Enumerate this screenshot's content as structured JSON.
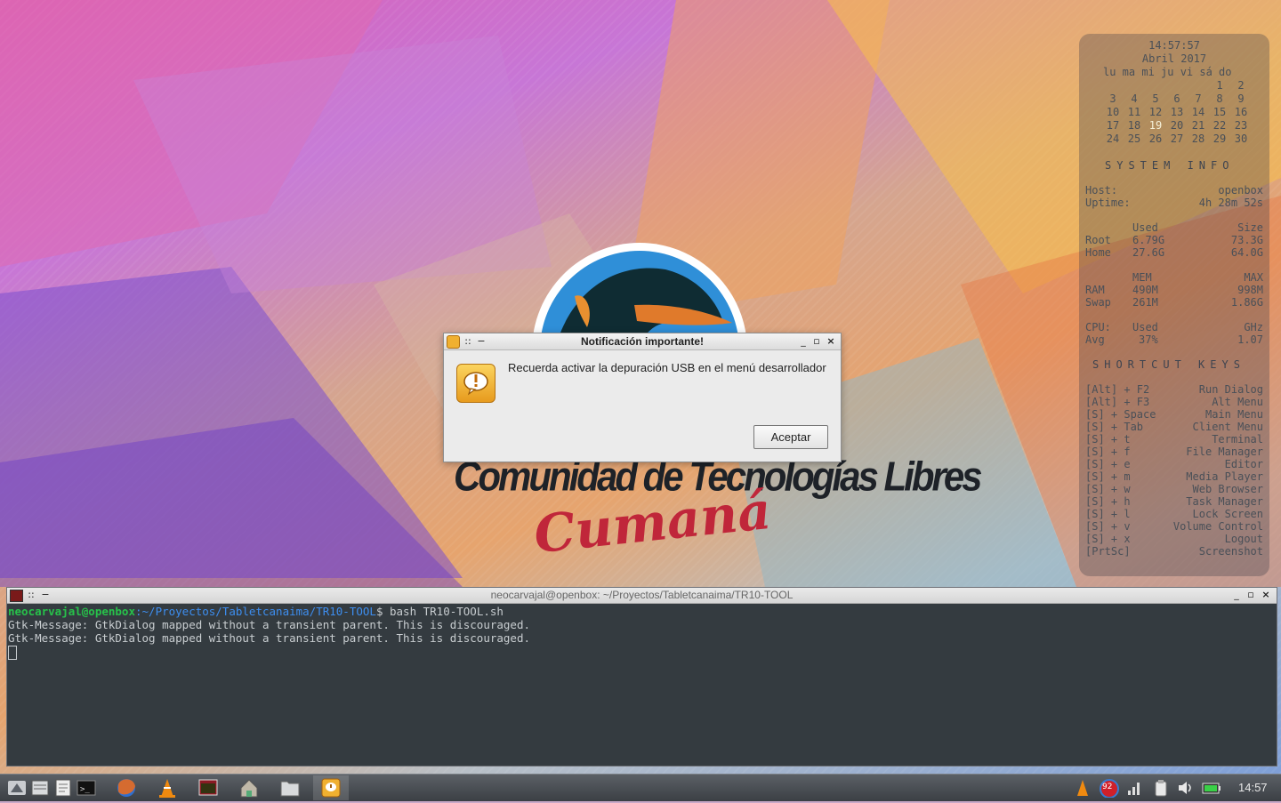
{
  "conky": {
    "clock": "14:57:57",
    "month": "Abril 2017",
    "weekdays": "lu ma mi ju vi sá do",
    "calendar_rows": [
      [
        "",
        "",
        "",
        "",
        "",
        "1",
        "2"
      ],
      [
        "3",
        "4",
        "5",
        "6",
        "7",
        "8",
        "9"
      ],
      [
        "10",
        "11",
        "12",
        "13",
        "14",
        "15",
        "16"
      ],
      [
        "17",
        "18",
        "19",
        "20",
        "21",
        "22",
        "23"
      ],
      [
        "24",
        "25",
        "26",
        "27",
        "28",
        "29",
        "30"
      ]
    ],
    "today": "19",
    "sysinfo_header": "SYSTEM INFO",
    "host_label": "Host:",
    "host_value": "openbox",
    "uptime_label": "Uptime:",
    "uptime_value": "4h 28m 52s",
    "disk_used_header": "Used",
    "disk_size_header": "Size",
    "root_label": "Root",
    "root_used": "6.79G",
    "root_size": "73.3G",
    "home_label": "Home",
    "home_used": "27.6G",
    "home_size": "64.0G",
    "mem_header": "MEM",
    "max_header": "MAX",
    "ram_label": "RAM",
    "ram_used": "490M",
    "ram_max": "998M",
    "swap_label": "Swap",
    "swap_used": "261M",
    "swap_max": "1.86G",
    "cpu_label": "CPU:",
    "cpu_used_header": "Used",
    "cpu_ghz_header": "GHz",
    "avg_label": "Avg",
    "cpu_used": "37%",
    "cpu_ghz": "1.07",
    "shortcut_header": "SHORTCUT KEYS",
    "shortcuts": [
      {
        "key": "[Alt] + F2",
        "action": "Run Dialog"
      },
      {
        "key": "[Alt] + F3",
        "action": "Alt Menu"
      },
      {
        "key": "[S] + Space",
        "action": "Main Menu"
      },
      {
        "key": "[S] + Tab",
        "action": "Client Menu"
      },
      {
        "key": "[S] + t",
        "action": "Terminal"
      },
      {
        "key": "[S] + f",
        "action": "File Manager"
      },
      {
        "key": "[S] + e",
        "action": "Editor"
      },
      {
        "key": "[S] + m",
        "action": "Media Player"
      },
      {
        "key": "[S] + w",
        "action": "Web Browser"
      },
      {
        "key": "[S] + h",
        "action": "Task Manager"
      },
      {
        "key": "[S] + l",
        "action": "Lock Screen"
      },
      {
        "key": "[S] + v",
        "action": "Volume Control"
      },
      {
        "key": "[S] + x",
        "action": "Logout"
      },
      {
        "key": "[PrtSc]",
        "action": "Screenshot"
      }
    ]
  },
  "wallpaper_logo": {
    "title": "Comunidad de Tecnologías Libres",
    "script": "Cumaná"
  },
  "dialog": {
    "title": "Notificación importante!",
    "message": "Recuerda activar la depuración USB en el menú desarrollador",
    "button": "Aceptar",
    "icon": "warning-icon"
  },
  "terminal": {
    "title": "neocarvajal@openbox: ~/Proyectos/Tabletcanaima/TR10-TOOL",
    "prompt_user": "neocarvajal@openbox",
    "prompt_path": ":~/Proyectos/Tabletcanaima/TR10-TOOL",
    "command": "$ bash TR10-TOOL.sh",
    "output": [
      "Gtk-Message: GtkDialog mapped without a transient parent. This is discouraged.",
      "Gtk-Message: GtkDialog mapped without a transient parent. This is discouraged."
    ]
  },
  "taskbar": {
    "launchers": [
      "menu-icon",
      "file-manager-icon",
      "text-editor-icon",
      "terminal-icon",
      "firefox-icon",
      "vlc-icon",
      "terminal-window-icon",
      "home-folder-icon",
      "folder-icon",
      "notification-icon"
    ],
    "tray_badge": "92",
    "clock": "14:57"
  },
  "colors": {
    "prompt_user": "#27c24a",
    "prompt_path": "#3d8ef0",
    "terminal_bg": "#343b40",
    "dialog_bg": "#ebebeb",
    "accent_red": "#c0263a"
  }
}
